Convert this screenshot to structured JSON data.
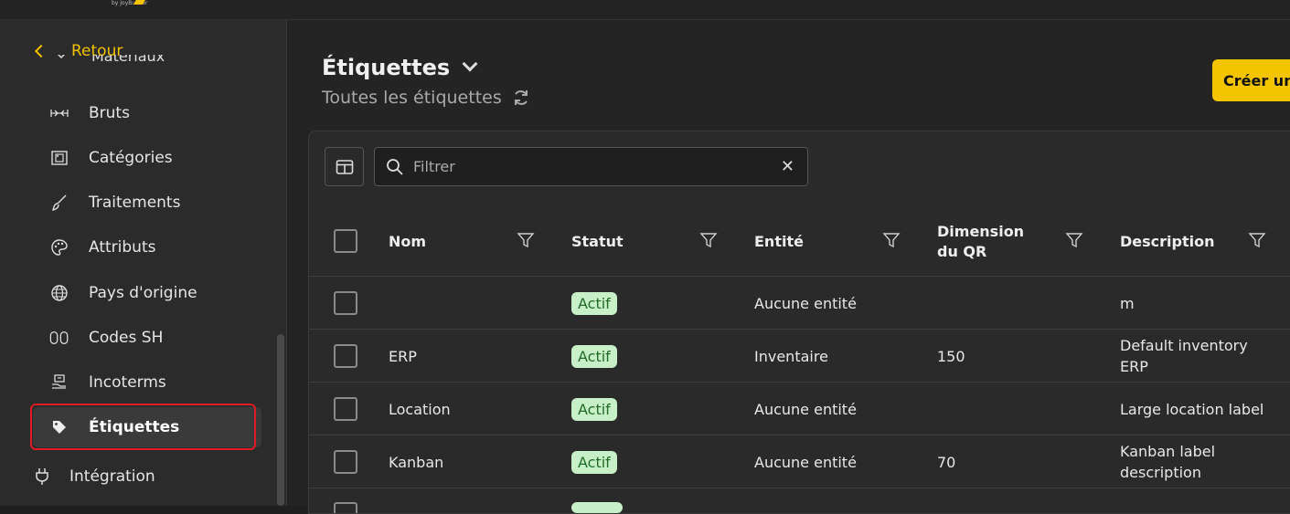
{
  "logo": {
    "sub": "by JoyBuilder"
  },
  "sidebar": {
    "back_label": "Retour",
    "cut_item": "Matériaux",
    "items": [
      {
        "label": "Bruts",
        "icon": "ruler-horizontal-icon"
      },
      {
        "label": "Catégories",
        "icon": "category-frame-icon"
      },
      {
        "label": "Traitements",
        "icon": "brush-icon"
      },
      {
        "label": "Attributs",
        "icon": "palette-icon"
      },
      {
        "label": "Pays d'origine",
        "icon": "globe-icon"
      },
      {
        "label": "Codes SH",
        "icon": "codes-icon"
      },
      {
        "label": "Incoterms",
        "icon": "incoterm-icon"
      },
      {
        "label": "Étiquettes",
        "icon": "tag-icon"
      }
    ],
    "integration_label": "Intégration"
  },
  "header": {
    "title": "Étiquettes",
    "subtitle": "Toutes les étiquettes",
    "create_button": "Créer une"
  },
  "toolbar": {
    "filter_placeholder": "Filtrer"
  },
  "table": {
    "columns": [
      "Nom",
      "Statut",
      "Entité",
      "Dimension du QR",
      "Description"
    ],
    "rows": [
      {
        "nom": "",
        "statut": "Actif",
        "entite": "Aucune entité",
        "dimension": "",
        "description": "m"
      },
      {
        "nom": "ERP",
        "statut": "Actif",
        "entite": "Inventaire",
        "dimension": "150",
        "description": "Default inventory ERP"
      },
      {
        "nom": "Location",
        "statut": "Actif",
        "entite": "Aucune entité",
        "dimension": "",
        "description": "Large location label"
      },
      {
        "nom": "Kanban",
        "statut": "Actif",
        "entite": "Aucune entité",
        "dimension": "70",
        "description": "Kanban label description"
      }
    ]
  },
  "colors": {
    "accent": "#f2c500",
    "active_outline": "#e01b24",
    "badge_bg": "#c8f0c8",
    "badge_text": "#226b26"
  }
}
